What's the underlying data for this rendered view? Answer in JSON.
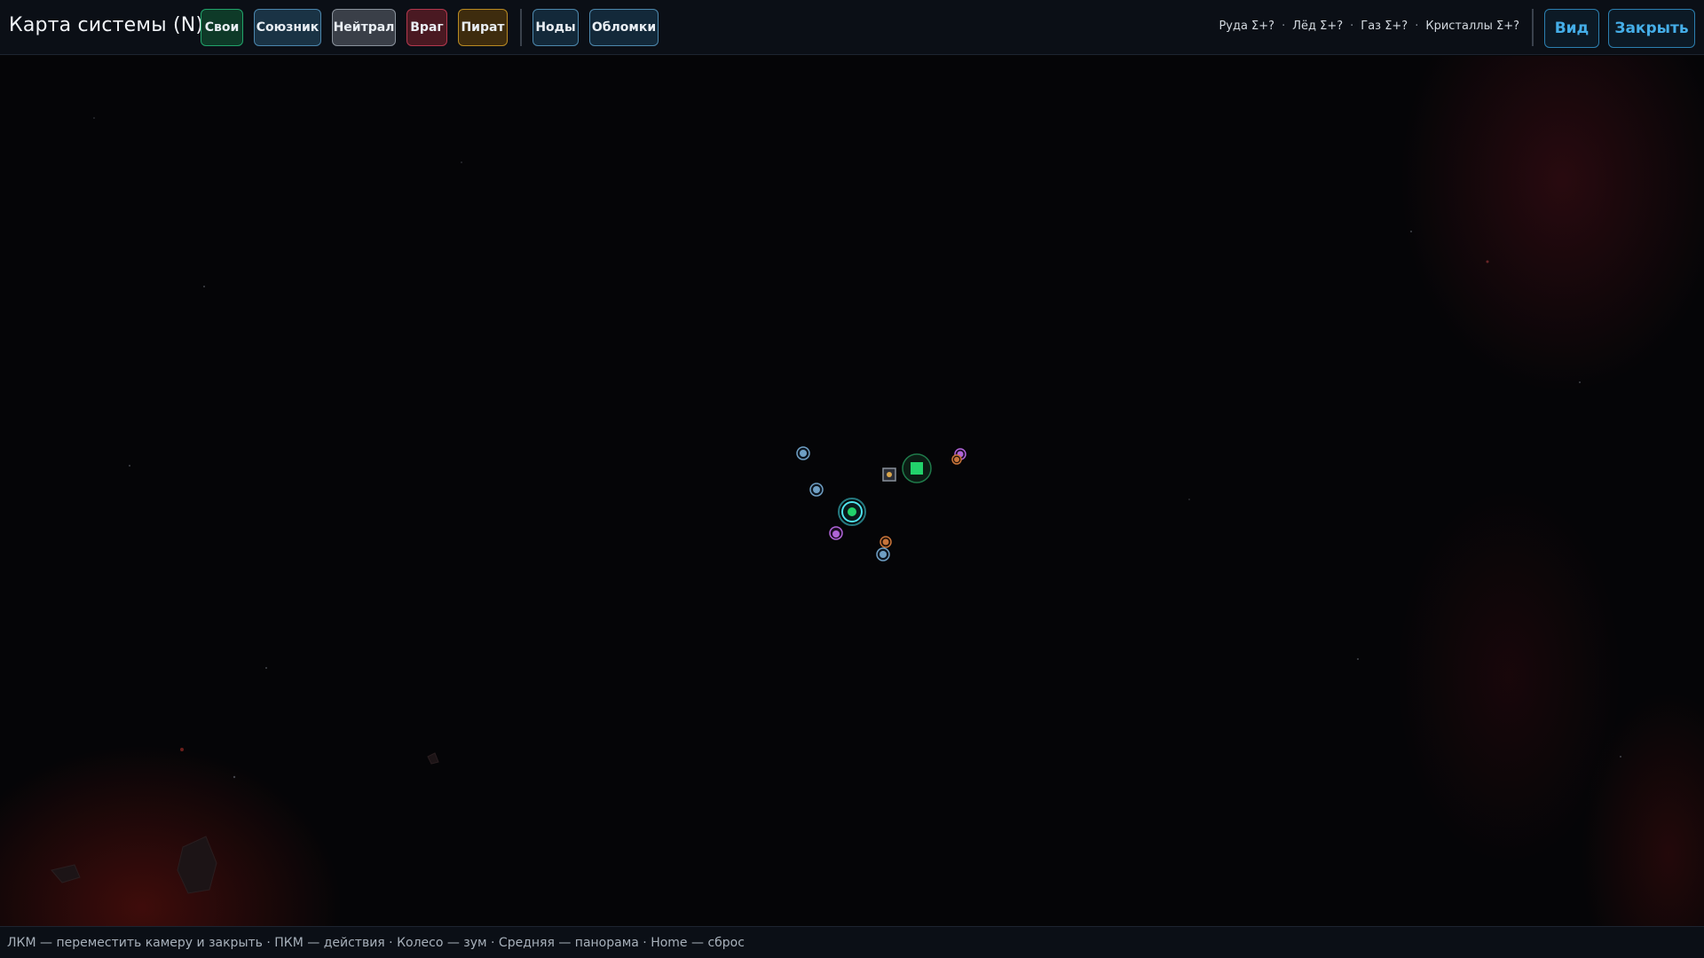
{
  "header": {
    "title": "Карта системы (N)",
    "filters": {
      "own": "Свои",
      "ally": "Союзник",
      "neutral": "Нейтрал",
      "enemy": "Враг",
      "pirate": "Пират",
      "nodes": "Ноды",
      "debris": "Обломки"
    },
    "resources": {
      "ore": "Руда Σ+?",
      "ice": "Лёд Σ+?",
      "gas": "Газ Σ+?",
      "crystals": "Кристаллы Σ+?",
      "separator": "·"
    },
    "view_label": "Вид",
    "close_label": "Закрыть"
  },
  "colors": {
    "own": "#22d36b",
    "ally": "#4b86ad",
    "neutral": "#8a929c",
    "enemy": "#b3384d",
    "pirate": "#b98a22",
    "accent": "#45aee8",
    "node_blue": "#6f9fc4",
    "node_purple": "#b064d8",
    "node_orange": "#c8743a"
  },
  "map": {
    "objects": [
      {
        "kind": "player-ship",
        "icon": "player-ship-icon"
      },
      {
        "kind": "own-station",
        "icon": "station-icon"
      },
      {
        "kind": "ice-node",
        "icon": "resource-node-icon"
      },
      {
        "kind": "ice-node",
        "icon": "resource-node-icon"
      },
      {
        "kind": "gas-node",
        "icon": "resource-node-icon"
      },
      {
        "kind": "ore-node",
        "icon": "resource-node-icon"
      },
      {
        "kind": "ice-node",
        "icon": "resource-node-icon"
      },
      {
        "kind": "crystal-node",
        "icon": "resource-node-icon"
      },
      {
        "kind": "debris",
        "icon": "debris-icon"
      }
    ]
  },
  "footer": {
    "hint": "ЛКМ — переместить камеру и закрыть · ПКМ — действия · Колесо — зум · Средняя — панорама · Home — сброс"
  }
}
